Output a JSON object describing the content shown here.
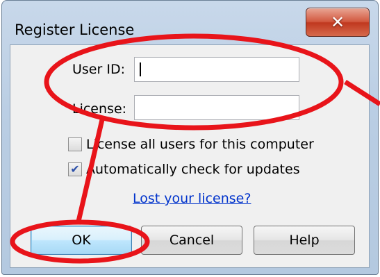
{
  "window": {
    "title": "Register License",
    "close_icon": "close-icon"
  },
  "form": {
    "user_id_label": "User ID:",
    "user_id_value": "",
    "license_label": "License:",
    "license_value": ""
  },
  "options": {
    "all_users_label": "License all users for this computer",
    "all_users_checked": false,
    "auto_update_label": "Automatically check for updates",
    "auto_update_checked": true
  },
  "links": {
    "lost_license": "Lost your license?"
  },
  "buttons": {
    "ok": "OK",
    "cancel": "Cancel",
    "help": "Help"
  },
  "annotation": {
    "color": "#e8141a"
  }
}
